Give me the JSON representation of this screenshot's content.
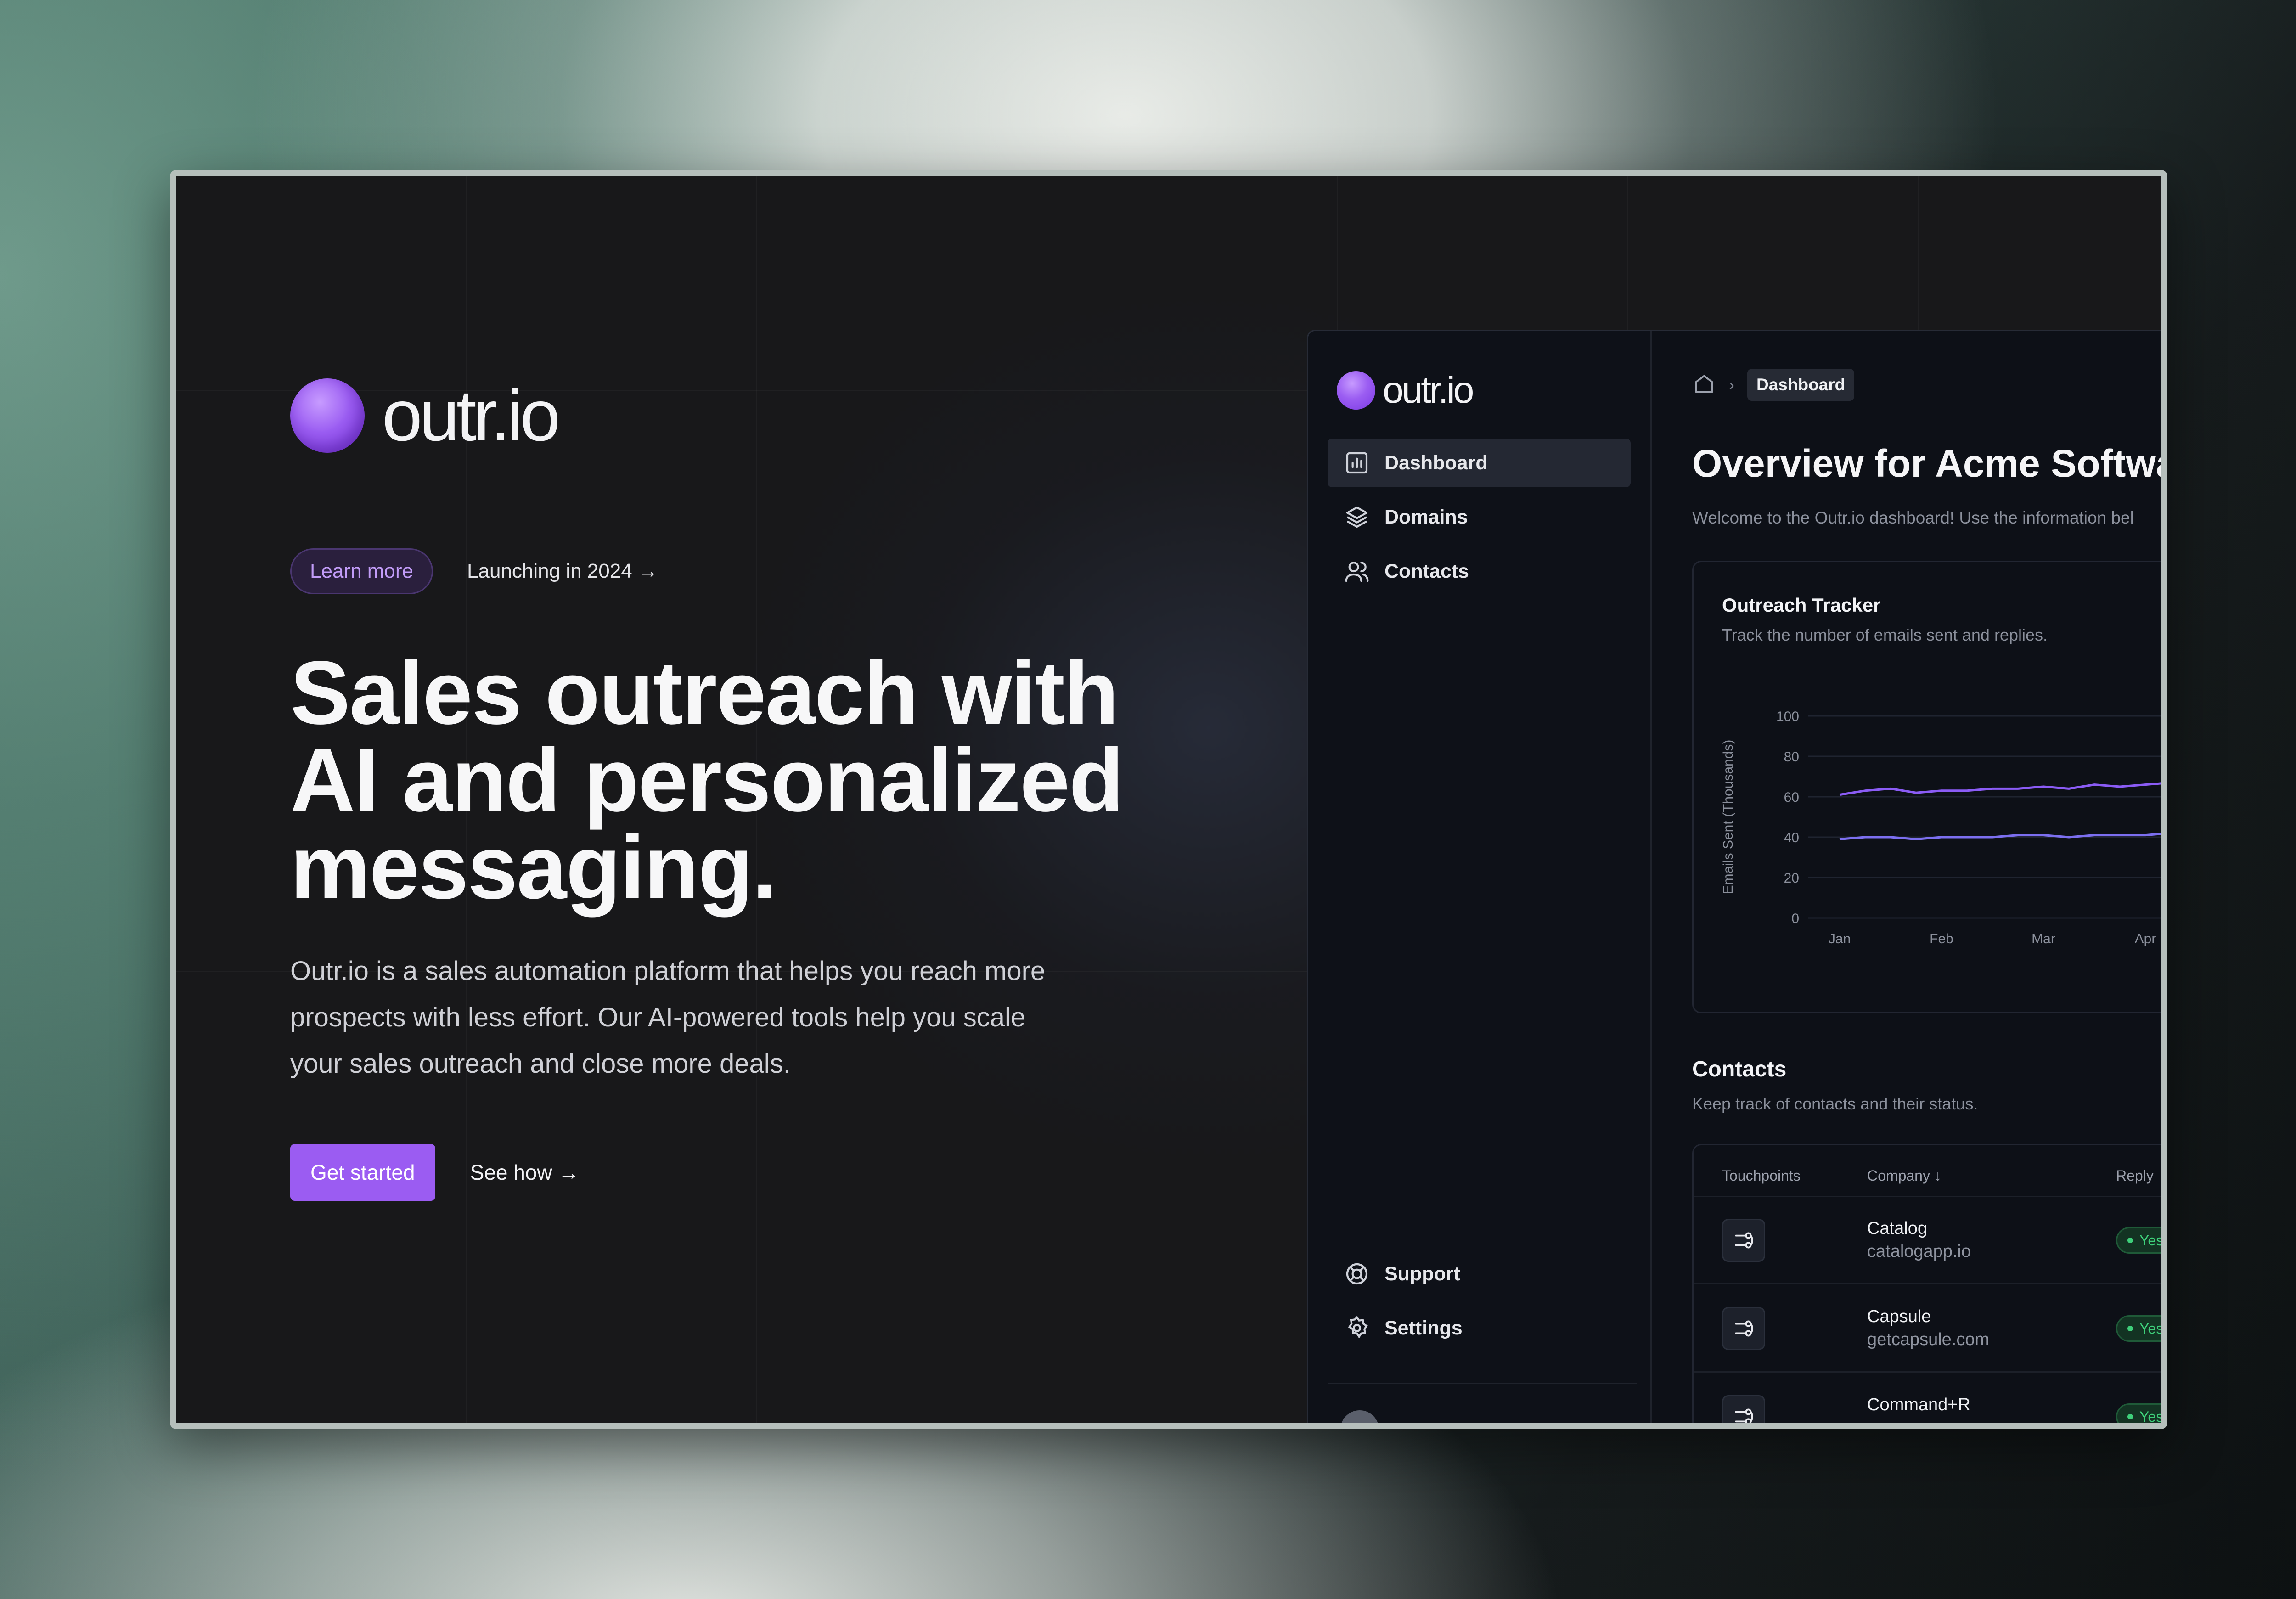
{
  "hero": {
    "logo_text": "outr.io",
    "badge_label": "Learn more",
    "launch_text": "Launching in 2024 →",
    "headline_lines": [
      "Sales outreach with",
      "AI and personalized",
      "messaging."
    ],
    "paragraph_lines": [
      "Outr.io is a sales automation platform that helps you reach more",
      "prospects with less effort. Our AI-powered tools help you scale",
      "your sales outreach and close more deals."
    ],
    "primary_cta": "Get started",
    "secondary_cta": "See how →"
  },
  "app": {
    "logo_text": "outr.io",
    "nav": [
      {
        "label": "Dashboard",
        "icon": "bar-chart-icon",
        "active": true
      },
      {
        "label": "Domains",
        "icon": "layers-icon",
        "active": false
      },
      {
        "label": "Contacts",
        "icon": "users-icon",
        "active": false
      }
    ],
    "bottom_nav": [
      {
        "label": "Support",
        "icon": "lifebuoy-icon"
      },
      {
        "label": "Settings",
        "icon": "gear-icon"
      }
    ],
    "breadcrumb": {
      "home_icon": "home-icon",
      "current": "Dashboard"
    },
    "title": "Overview for Acme Softwa",
    "subtitle": "Welcome to the Outr.io dashboard! Use the information bel",
    "tracker": {
      "title": "Outreach Tracker",
      "subtitle": "Track the number of emails sent and replies."
    },
    "contacts": {
      "title": "Contacts",
      "subtitle": "Keep track of contacts and their status.",
      "columns": [
        "Touchpoints",
        "Company",
        "Reply"
      ],
      "rows": [
        {
          "name": "Catalog",
          "domain": "catalogapp.io",
          "reply": "Yes"
        },
        {
          "name": "Capsule",
          "domain": "getcapsule.com",
          "reply": "Yes"
        },
        {
          "name": "Command+R",
          "domain": "",
          "reply": "Yes"
        }
      ]
    }
  },
  "chart_data": {
    "type": "line",
    "ylabel": "Emails Sent (Thousands)",
    "ylim": [
      0,
      100
    ],
    "yticks": [
      0,
      20,
      40,
      60,
      80,
      100
    ],
    "categories": [
      "Jan",
      "Feb",
      "Mar",
      "Apr"
    ],
    "grid": true,
    "series": [
      {
        "color": "#8b5cf6",
        "x": [
          0,
          0.25,
          0.5,
          0.75,
          1,
          1.25,
          1.5,
          1.75,
          2,
          2.25,
          2.5,
          2.75,
          3,
          3.25
        ],
        "values": [
          61,
          63,
          64,
          62,
          63,
          63,
          64,
          64,
          65,
          64,
          66,
          65,
          66,
          67
        ]
      },
      {
        "color": "#7c6ff0",
        "x": [
          0,
          0.25,
          0.5,
          0.75,
          1,
          1.25,
          1.5,
          1.75,
          2,
          2.25,
          2.5,
          2.75,
          3,
          3.25
        ],
        "values": [
          39,
          40,
          40,
          39,
          40,
          40,
          40,
          41,
          41,
          40,
          41,
          41,
          41,
          42
        ]
      }
    ]
  }
}
